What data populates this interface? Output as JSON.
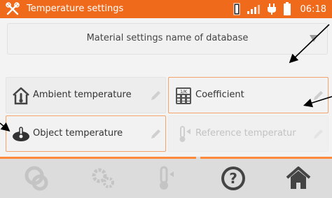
{
  "statusbar": {
    "title": "Temperature settings",
    "time": "06:18",
    "icons": [
      "tools-icon",
      "battery-probe-icon",
      "signal-icon",
      "plug-icon",
      "battery-icon"
    ]
  },
  "database": {
    "label": "Material settings name of database",
    "icon": "dropdown-triangle-icon"
  },
  "fields": [
    {
      "label": "Ambient temperature",
      "icon": "house-thermometer-icon",
      "enabled": true,
      "selected": false
    },
    {
      "label": "Coefficient",
      "icon": "calculator-icon",
      "enabled": true,
      "selected": true
    },
    {
      "label": "Object temperature",
      "icon": "object-temperature-icon",
      "enabled": true,
      "selected": true
    },
    {
      "label": "Reference temperatur",
      "icon": "thermometer-reference-icon",
      "enabled": false,
      "selected": false
    }
  ],
  "tabs": [
    "measurement-icon",
    "settings-gears-icon",
    "thermometer-icon",
    "help-icon",
    "home-icon"
  ],
  "colors": {
    "accent": "#f06a1c",
    "selected_border": "#f4a36a",
    "tab_indicator": "#ff8a3c"
  }
}
